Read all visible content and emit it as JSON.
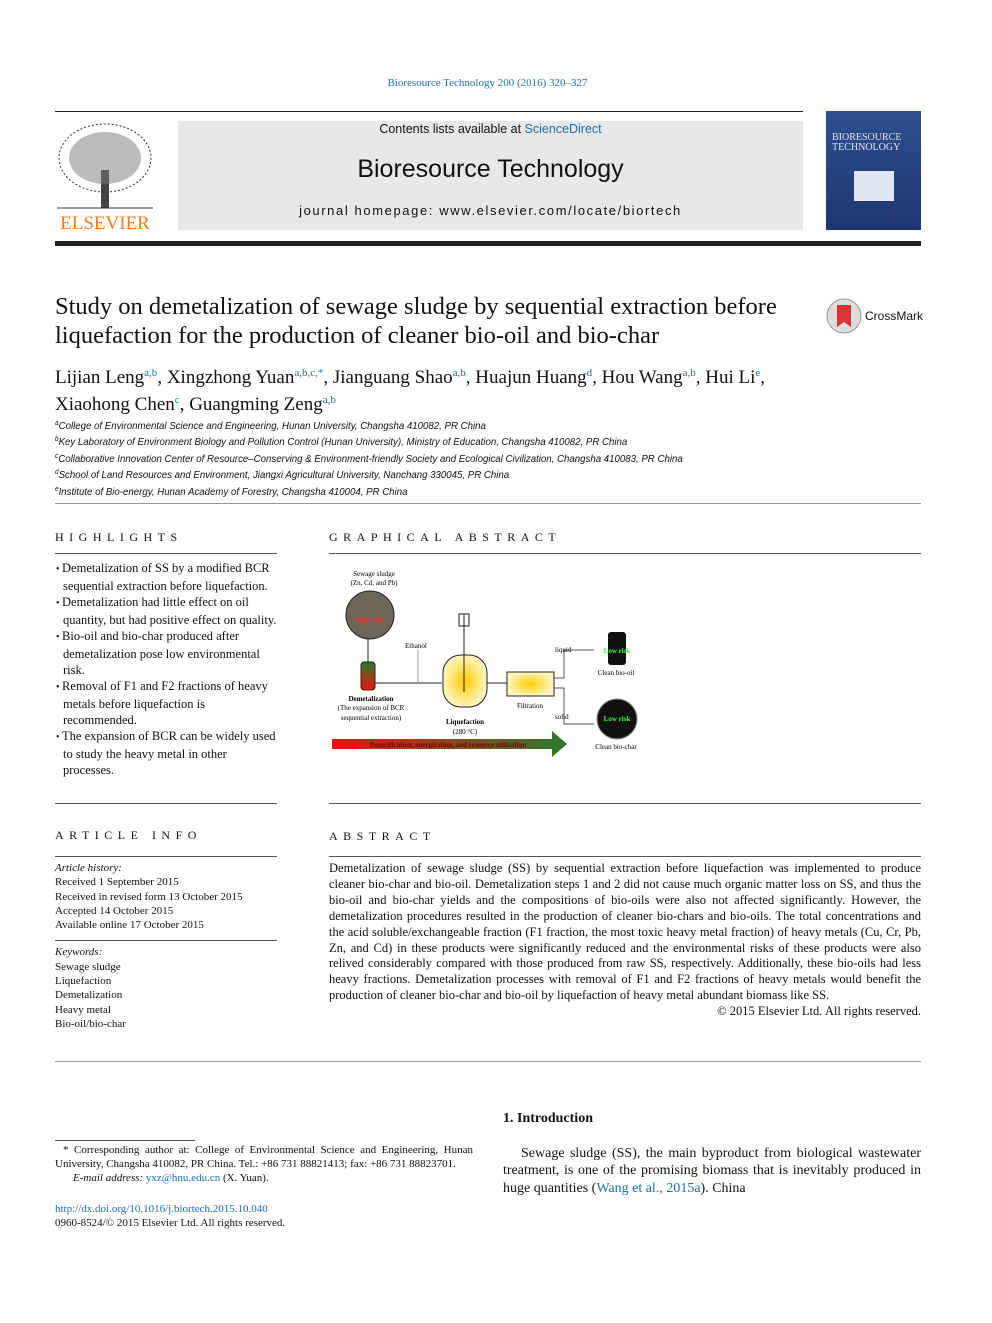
{
  "header": {
    "journal_ref": "Bioresource Technology 200 (2016) 320–327",
    "contents_prefix": "Contents lists available at ",
    "sciencedirect": "ScienceDirect",
    "journal_title": "Bioresource Technology",
    "homepage": "journal homepage: www.elsevier.com/locate/biortech",
    "publisher": "ELSEVIER",
    "cover_title": "BIORESOURCE TECHNOLOGY",
    "crossmark": "CrossMark"
  },
  "article": {
    "title": "Study on demetalization of sewage sludge by sequential extraction before liquefaction for the production of cleaner bio-oil and bio-char",
    "authors": [
      {
        "name": "Lijian Leng",
        "sup": "a,b"
      },
      {
        "name": "Xingzhong Yuan",
        "sup": "a,b,c,*"
      },
      {
        "name": "Jianguang Shao",
        "sup": "a,b"
      },
      {
        "name": "Huajun Huang",
        "sup": "d"
      },
      {
        "name": "Hou Wang",
        "sup": "a,b"
      },
      {
        "name": "Hui Li",
        "sup": "e"
      },
      {
        "name": "Xiaohong Chen",
        "sup": "c"
      },
      {
        "name": "Guangming Zeng",
        "sup": "a,b"
      }
    ],
    "affiliations": [
      {
        "k": "a",
        "t": "College of Environmental Science and Engineering, Hunan University, Changsha 410082, PR China"
      },
      {
        "k": "b",
        "t": "Key Laboratory of Environment Biology and Pollution Control (Hunan University), Ministry of Education, Changsha 410082, PR China"
      },
      {
        "k": "c",
        "t": "Collaborative Innovation Center of Resource–Conserving & Environment-friendly Society and Ecological Civilization, Changsha 410083, PR China"
      },
      {
        "k": "d",
        "t": "School of Land Resources and Environment, Jiangxi Agricultural University, Nanchang 330045, PR China"
      },
      {
        "k": "e",
        "t": "Institute of Bio-energy, Hunan Academy of Forestry, Changsha 410004, PR China"
      }
    ]
  },
  "highlights": {
    "heading": "HIGHLIGHTS",
    "items": [
      "Demetalization of SS by a modified BCR sequential extraction before liquefaction.",
      "Demetalization had little effect on oil quantity, but had positive effect on quality.",
      "Bio-oil and bio-char produced after demetalization pose low environmental risk.",
      "Removal of F1 and F2 fractions of heavy metals before liquefaction is recommended.",
      "The expansion of BCR can be widely used to study the heavy metal in other processes."
    ]
  },
  "graphical_abstract": {
    "heading": "GRAPHICAL ABSTRACT",
    "sludge": "Sewage sludge",
    "metals": "(Zn, Cd, and Pb)",
    "high_risk": "High risk",
    "ethanol": "Ethanol",
    "demetalization": "Demetalization",
    "bcr1": "(The expansion of BCR",
    "bcr2": "sequential extraction)",
    "liquefaction": "Liquefaction",
    "temp": "(280 °C)",
    "filtration": "Filtration",
    "liquid": "liquid",
    "solid": "solid",
    "low_risk": "Low risk",
    "bio_oil": "Clean bio-oil",
    "bio_char": "Clean bio-char",
    "arrow": "Detoxification, energization, and resource utilization"
  },
  "article_info": {
    "heading": "ARTICLE INFO",
    "history_label": "Article history:",
    "history": [
      "Received 1 September 2015",
      "Received in revised form 13 October 2015",
      "Accepted 14 October 2015",
      "Available online 17 October 2015"
    ],
    "keywords_label": "Keywords:",
    "keywords": [
      "Sewage sludge",
      "Liquefaction",
      "Demetalization",
      "Heavy metal",
      "Bio-oil/bio-char"
    ]
  },
  "abstract": {
    "heading": "ABSTRACT",
    "text": "Demetalization of sewage sludge (SS) by sequential extraction before liquefaction was implemented to produce cleaner bio-char and bio-oil. Demetalization steps 1 and 2 did not cause much organic matter loss on SS, and thus the bio-oil and bio-char yields and the compositions of bio-oils were also not affected significantly. However, the demetalization procedures resulted in the production of cleaner bio-chars and bio-oils. The total concentrations and the acid soluble/exchangeable fraction (F1 fraction, the most toxic heavy metal fraction) of heavy metals (Cu, Cr, Pb, Zn, and Cd) in these products were significantly reduced and the environmental risks of these products were also relived considerably compared with those produced from raw SS, respectively. Additionally, these bio-oils had less heavy fractions. Demetalization processes with removal of F1 and F2 fractions of heavy metals would benefit the production of cleaner bio-char and bio-oil by liquefaction of heavy metal abundant biomass like SS.",
    "copyright": "© 2015 Elsevier Ltd. All rights reserved."
  },
  "footnotes": {
    "corresponding": "* Corresponding author at: College of Environmental Science and Engineering, Hunan University, Changsha 410082, PR China. Tel.: +86 731 88821413; fax: +86 731 88823701.",
    "email_label": "E-mail address: ",
    "email": "yxz@hnu.edu.cn",
    "email_suffix": " (X. Yuan).",
    "doi": "http://dx.doi.org/10.1016/j.biortech.2015.10.040",
    "issn": "0960-8524/© 2015 Elsevier Ltd. All rights reserved."
  },
  "introduction": {
    "heading": "1. Introduction",
    "text_before": "Sewage sludge (SS), the main byproduct from biological wastewater treatment, is one of the promising biomass that is inevitably produced in huge quantities (",
    "cite": "Wang et al., 2015a",
    "text_after": "). China"
  }
}
